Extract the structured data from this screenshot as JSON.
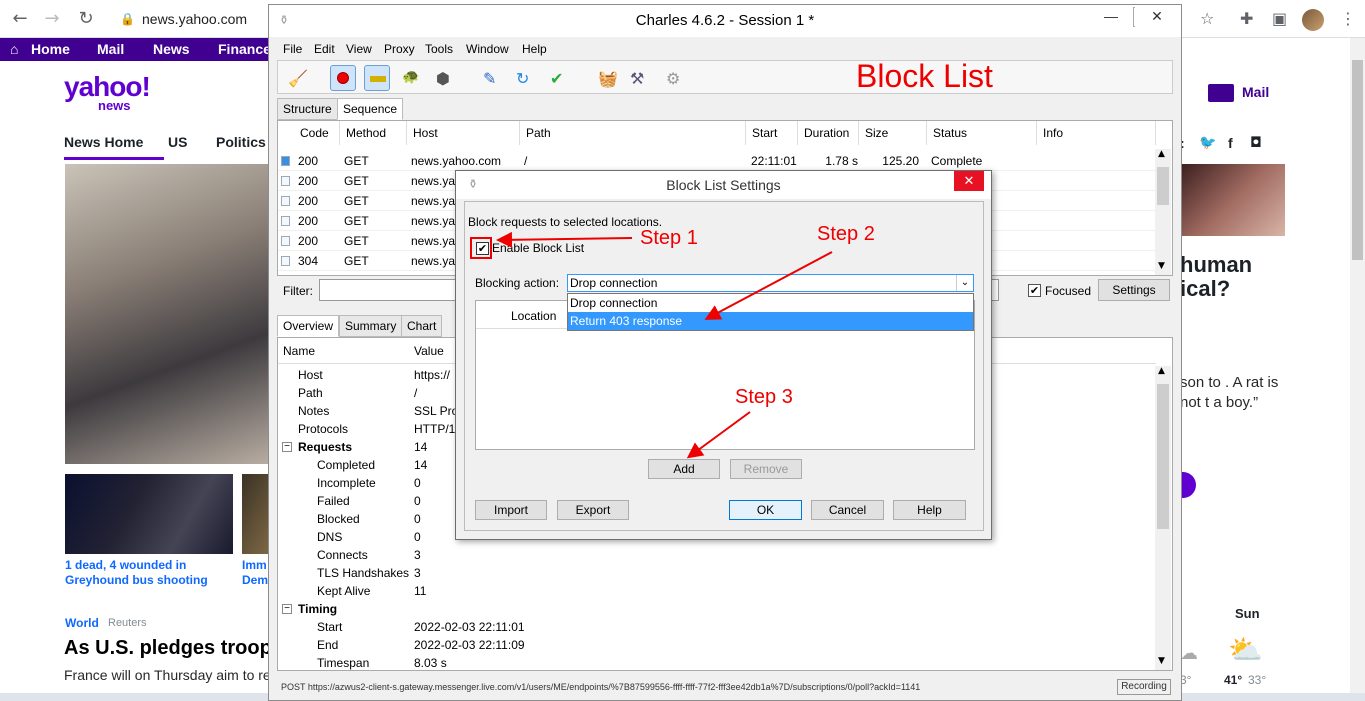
{
  "browser": {
    "url": "news.yahoo.com",
    "back_icon": "←",
    "forward_icon": "→",
    "reload_icon": "↻"
  },
  "yahoo": {
    "nav": [
      "Home",
      "Mail",
      "News",
      "Finance"
    ],
    "logo": "yahoo!",
    "logo_sub": "news",
    "tabs": [
      "News Home",
      "US",
      "Politics"
    ],
    "caption1": "1 dead, 4 wounded in Greyhound bus shooting",
    "caption2": "Imm Dem",
    "section": "World",
    "source": "Reuters",
    "headline": "As U.S. pledges troop",
    "subtext": "France will on Thursday aim to re further reassurance to the Black",
    "mail_label": "Mail",
    "right_headline": "human ical?",
    "right_text": "son to . A rat is not t a boy.”",
    "weather_day": "Sun",
    "weather_high": "41°",
    "weather_low": "33°",
    "weather_low_left": "3°"
  },
  "charles": {
    "title": "Charles 4.6.2 - Session 1 *",
    "menu": [
      "File",
      "Edit",
      "View",
      "Proxy",
      "Tools",
      "Window",
      "Help"
    ],
    "annotation_title": "Block List",
    "tabs_top": [
      "Structure",
      "Sequence"
    ],
    "columns": [
      "Code",
      "Method",
      "Host",
      "Path",
      "Start",
      "Duration",
      "Size",
      "Status",
      "Info"
    ],
    "rows": [
      {
        "code": "200",
        "method": "GET",
        "host": "news.yahoo.com",
        "path": "/",
        "start": "22:11:01",
        "duration": "1.78 s",
        "size": "125.20 KB",
        "status": "Complete"
      },
      {
        "code": "200",
        "method": "GET",
        "host": "news.yah",
        "path": "",
        "start": "",
        "duration": "",
        "size": "",
        "status": ""
      },
      {
        "code": "200",
        "method": "GET",
        "host": "news.yah",
        "path": "",
        "start": "",
        "duration": "",
        "size": "",
        "status": ""
      },
      {
        "code": "200",
        "method": "GET",
        "host": "news.yah",
        "path": "",
        "start": "",
        "duration": "",
        "size": "",
        "status": ""
      },
      {
        "code": "200",
        "method": "GET",
        "host": "news.yah",
        "path": "",
        "start": "",
        "duration": "",
        "size": "",
        "status": ""
      },
      {
        "code": "304",
        "method": "GET",
        "host": "news.yah",
        "path": "",
        "start": "",
        "duration": "",
        "size": "",
        "status": ""
      }
    ],
    "filter_label": "Filter:",
    "focused_label": "Focused",
    "settings_label": "Settings",
    "tabs_bottom": [
      "Overview",
      "Summary",
      "Chart"
    ],
    "detail_headers": [
      "Name",
      "Value"
    ],
    "detail": [
      {
        "name": "Host",
        "value": "https://",
        "level": 1
      },
      {
        "name": "Path",
        "value": "/",
        "level": 1
      },
      {
        "name": "Notes",
        "value": "SSL Prox",
        "level": 1
      },
      {
        "name": "Protocols",
        "value": "HTTP/1",
        "level": 1
      },
      {
        "name": "Requests",
        "value": "14",
        "level": 0
      },
      {
        "name": "Completed",
        "value": "14",
        "level": 2
      },
      {
        "name": "Incomplete",
        "value": "0",
        "level": 2
      },
      {
        "name": "Failed",
        "value": "0",
        "level": 2
      },
      {
        "name": "Blocked",
        "value": "0",
        "level": 2
      },
      {
        "name": "DNS",
        "value": "0",
        "level": 2
      },
      {
        "name": "Connects",
        "value": "3",
        "level": 2
      },
      {
        "name": "TLS Handshakes",
        "value": "3",
        "level": 2
      },
      {
        "name": "Kept Alive",
        "value": "11",
        "level": 2
      },
      {
        "name": "Timing",
        "value": "",
        "level": 0
      },
      {
        "name": "Start",
        "value": "2022-02-03 22:11:01",
        "level": 2
      },
      {
        "name": "End",
        "value": "2022-02-03 22:11:09",
        "level": 2
      },
      {
        "name": "Timespan",
        "value": "8.03 s",
        "level": 2
      }
    ],
    "status_text": "POST https://azwus2-client-s.gateway.messenger.live.com/v1/users/ME/endpoints/%7B87599556-ffff-ffff-77f2-fff3ee42db1a%7D/subscriptions/0/poll?ackId=1141",
    "recording_label": "Recording"
  },
  "dialog": {
    "title": "Block List Settings",
    "description": "Block requests to selected locations.",
    "enable_label": "Enable Block List",
    "enable_checked": true,
    "blocking_label": "Blocking action:",
    "blocking_value": "Drop connection",
    "options": [
      "Drop connection",
      "Return 403 response"
    ],
    "location_column": "Location",
    "add_label": "Add",
    "remove_label": "Remove",
    "import_label": "Import",
    "export_label": "Export",
    "ok_label": "OK",
    "cancel_label": "Cancel",
    "help_label": "Help",
    "close_icon": "✕"
  },
  "annotations": {
    "step1": "Step 1",
    "step2": "Step 2",
    "step3": "Step 3"
  },
  "colors": {
    "yahoo_purple": "#400090",
    "annotation_red": "#e00000",
    "select_blue": "#3399ff"
  }
}
